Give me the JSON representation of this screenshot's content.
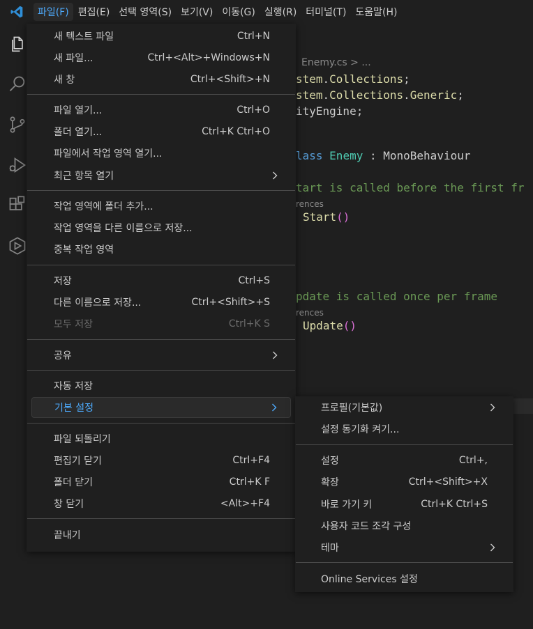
{
  "menubar": {
    "items": [
      "파일(F)",
      "편집(E)",
      "선택 영역(S)",
      "보기(V)",
      "이동(G)",
      "실행(R)",
      "터미널(T)",
      "도움말(H)"
    ],
    "active_index": 0
  },
  "activitybar": {
    "icons": [
      "explorer-icon",
      "search-icon",
      "source-control-icon",
      "run-debug-icon",
      "extensions-icon",
      "remote-icon"
    ]
  },
  "editor": {
    "breadcrumb": "Enemy.cs > ...",
    "lines": {
      "l1_a": "stem",
      "l1_b": ".",
      "l1_c": "Collections",
      "l1_d": ";",
      "l2_a": "stem",
      "l2_b": ".",
      "l2_c": "Collections",
      "l2_d": ".",
      "l2_e": "Generic",
      "l2_f": ";",
      "l3_a": "ityEngine",
      "l3_b": ";",
      "l4_a": "lass ",
      "l4_b": "Enemy",
      "l4_c": " : ",
      "l4_d": "MonoBehaviour",
      "l5": "tart is called before the first fr",
      "lens1": "rences",
      "l6_a": "Start",
      "l6_b": "()",
      "l7": "pdate is called once per frame",
      "lens2": "rences",
      "l8_a": "Update",
      "l8_b": "()"
    }
  },
  "file_menu": {
    "new_text_file": {
      "label": "새 텍스트 파일",
      "shortcut": "Ctrl+N"
    },
    "new_file": {
      "label": "새 파일...",
      "shortcut": "Ctrl+<Alt>+Windows+N"
    },
    "new_window": {
      "label": "새 창",
      "shortcut": "Ctrl+<Shift>+N"
    },
    "open_file": {
      "label": "파일 열기...",
      "shortcut": "Ctrl+O"
    },
    "open_folder": {
      "label": "폴더 열기...",
      "shortcut": "Ctrl+K Ctrl+O"
    },
    "open_workspace": {
      "label": "파일에서 작업 영역 열기..."
    },
    "open_recent": {
      "label": "최근 항목 열기"
    },
    "add_folder": {
      "label": "작업 영역에 폴더 추가..."
    },
    "save_workspace_as": {
      "label": "작업 영역을 다른 이름으로 저장..."
    },
    "duplicate_workspace": {
      "label": "중복 작업 영역"
    },
    "save": {
      "label": "저장",
      "shortcut": "Ctrl+S"
    },
    "save_as": {
      "label": "다른 이름으로 저장...",
      "shortcut": "Ctrl+<Shift>+S"
    },
    "save_all": {
      "label": "모두 저장",
      "shortcut": "Ctrl+K S"
    },
    "share": {
      "label": "공유"
    },
    "auto_save": {
      "label": "자동 저장"
    },
    "preferences": {
      "label": "기본 설정"
    },
    "revert_file": {
      "label": "파일 되돌리기"
    },
    "close_editor": {
      "label": "편집기 닫기",
      "shortcut": "Ctrl+F4"
    },
    "close_folder": {
      "label": "폴더 닫기",
      "shortcut": "Ctrl+K F"
    },
    "close_window": {
      "label": "창 닫기",
      "shortcut": "<Alt>+F4"
    },
    "exit": {
      "label": "끝내기"
    }
  },
  "preferences_menu": {
    "profile": {
      "label": "프로필(기본값)"
    },
    "settings_sync": {
      "label": "설정 동기화 켜기..."
    },
    "settings": {
      "label": "설정",
      "shortcut": "Ctrl+,"
    },
    "extensions": {
      "label": "확장",
      "shortcut": "Ctrl+<Shift>+X"
    },
    "keyboard_shortcuts": {
      "label": "바로 가기 키",
      "shortcut": "Ctrl+K Ctrl+S"
    },
    "user_snippets": {
      "label": "사용자 코드 조각 구성"
    },
    "themes": {
      "label": "테마"
    },
    "online_services": {
      "label": "Online Services 설정"
    }
  }
}
